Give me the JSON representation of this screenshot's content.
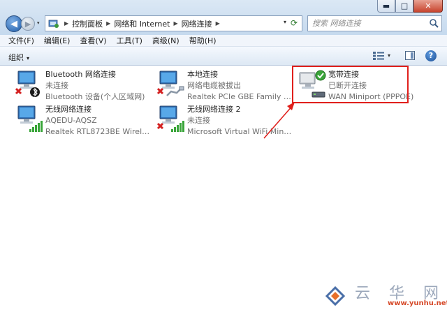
{
  "window": {
    "minimize_glyph": "▬",
    "maximize_glyph": "□",
    "close_glyph": "✕"
  },
  "navigation": {
    "back_icon": "back-arrow-icon",
    "forward_icon": "forward-arrow-icon",
    "history_glyph": "▾"
  },
  "address_bar": {
    "breadcrumbs": [
      "控制面板",
      "网络和 Internet",
      "网络连接"
    ],
    "separator": "▶",
    "dropdown_glyph": "▾",
    "refresh_glyph": "⟳"
  },
  "search": {
    "placeholder": "搜索 网络连接"
  },
  "menu": {
    "items": [
      "文件(F)",
      "编辑(E)",
      "查看(V)",
      "工具(T)",
      "高级(N)",
      "帮助(H)"
    ]
  },
  "command_bar": {
    "organize_label": "组织",
    "caret": "▾",
    "help_glyph": "?"
  },
  "connections": [
    {
      "name": "Bluetooth 网络连接",
      "status": "未连接",
      "device": "Bluetooth 设备(个人区域网)",
      "icon": "bluetooth-network-icon",
      "state_badge": "red-x"
    },
    {
      "name": "本地连接",
      "status": "网络电缆被拔出",
      "device": "Realtek PCIe GBE Family Contr...",
      "icon": "wired-network-icon",
      "state_badge": "red-x"
    },
    {
      "name": "宽带连接",
      "status": "已断开连接",
      "device": "WAN Miniport (PPPOE)",
      "icon": "broadband-modem-icon",
      "state_badge": "green-check"
    },
    {
      "name": "无线网络连接",
      "status": "AQEDU-AQSZ",
      "device": "Realtek RTL8723BE Wireless L...",
      "icon": "wireless-network-icon",
      "state_badge": "signal-bars"
    },
    {
      "name": "无线网络连接 2",
      "status": "未连接",
      "device": "Microsoft Virtual WiFi Minipor...",
      "icon": "wireless-network-icon",
      "state_badge": "red-x"
    }
  ],
  "annotation": {
    "highlight_color": "#e0201c",
    "arrow_color": "#e0201c"
  },
  "watermark": {
    "cn_text": "云 华 网",
    "url": "www.yunhu.net"
  }
}
